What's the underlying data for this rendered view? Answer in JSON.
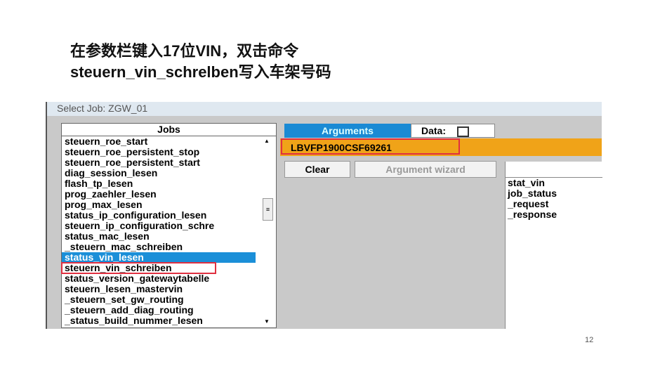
{
  "slide": {
    "title_line1": "在参数栏键入17位VIN，双击命令",
    "title_line2": "steuern_vin_schrelben写入车架号码",
    "page_number": "12"
  },
  "window": {
    "title": "Select Job: ZGW_01"
  },
  "jobs": {
    "header": "Jobs",
    "items": [
      "steuern_roe_start",
      "steuern_roe_persistent_stop",
      "steuern_roe_persistent_start",
      "diag_session_lesen",
      "flash_tp_lesen",
      "prog_zaehler_lesen",
      "prog_max_lesen",
      "status_ip_configuration_lesen",
      "steuern_ip_configuration_schre",
      "status_mac_lesen",
      "_steuern_mac_schreiben",
      "status_vin_lesen",
      "steuern_vin_schreiben",
      "status_version_gatewaytabelle",
      "steuern_lesen_mastervin",
      "_steuern_set_gw_routing",
      "_steuern_add_diag_routing",
      "_status_build_nummer_lesen"
    ],
    "selected": "status_vin_lesen",
    "highlighted": "steuern_vin_schreiben"
  },
  "arguments": {
    "tab_label": "Arguments",
    "data_label": "Data:",
    "data_checked": false,
    "value": "LBVFP1900CSF69261",
    "clear_label": "Clear",
    "wizard_label": "Argument wizard"
  },
  "results": {
    "items": [
      "stat_vin",
      "job_status",
      "_request",
      "_response"
    ]
  },
  "colors": {
    "selected": "#1b8fd8",
    "argument_bar": "#f0a318",
    "highlight_box": "#e03040"
  }
}
